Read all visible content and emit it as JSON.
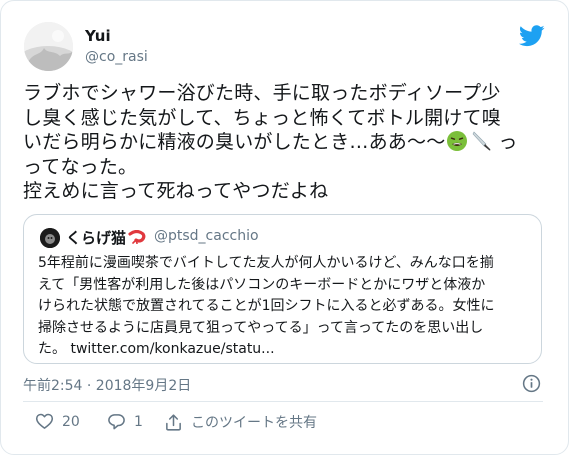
{
  "author": {
    "display_name": "Yui",
    "handle": "@co_rasi"
  },
  "tweet": {
    "lines": [
      "ラブホでシャワー浴びた時、手に取ったボディソープ少",
      "し臭く感じた気がして、ちょっと怖くてボトル開けて嗅",
      "いだら明らかに精液の臭いがしたとき…ああ〜〜",
      "ってなった。",
      "控えめに言って死ねってやつだよね"
    ],
    "line3_tail": "っ",
    "emojis": [
      "nauseated-face-emoji",
      "knife-emoji"
    ]
  },
  "quoted": {
    "display_name": "くらげ猫",
    "name_emoji": "shrimp-emoji",
    "handle": "@ptsd_cacchio",
    "lines": [
      "5年程前に漫画喫茶でバイトしてた友人が何人かいるけど、みんな口を揃",
      "えて「男性客が利用した後はパソコンのキーボードとかにワザと体液か",
      "けられた状態で放置されてることが1回シフトに入ると必ずある。女性に",
      "掃除させるように店員見て狙ってやってる」って言ってたのを思い出し"
    ],
    "last_line_prefix": "た。 ",
    "link": "twitter.com/konkazue/statu..."
  },
  "meta": {
    "timestamp": "午前2:54 · 2018年9月2日"
  },
  "actions": {
    "like_count": "20",
    "reply_count": "1",
    "share_label": "このツイートを共有"
  },
  "colors": {
    "twitter_blue": "#1da1f2",
    "text": "#14171a",
    "secondary": "#657786",
    "border": "#e1e8ed"
  }
}
